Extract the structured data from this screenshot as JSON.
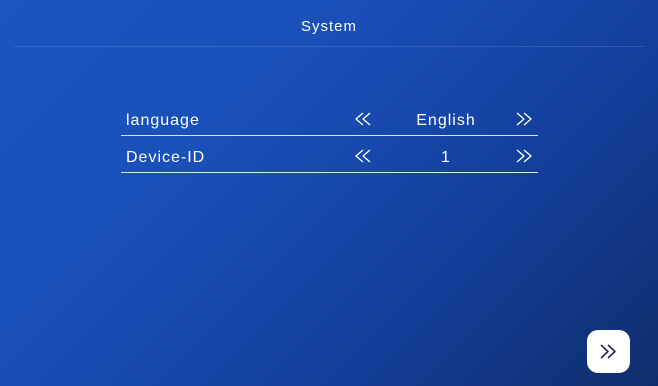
{
  "header": {
    "title": "System"
  },
  "settings": [
    {
      "label": "language",
      "value": "English",
      "prev_icon": "double-chevron-left-icon",
      "next_icon": "double-chevron-right-icon"
    },
    {
      "label": "Device-ID",
      "value": "1",
      "prev_icon": "double-chevron-left-icon",
      "next_icon": "double-chevron-right-icon"
    }
  ],
  "footer": {
    "next_icon": "double-chevron-right-icon"
  },
  "colors": {
    "background_top": "#1a55c0",
    "background_bottom": "#0f2d6c",
    "text": "#ffffff"
  }
}
